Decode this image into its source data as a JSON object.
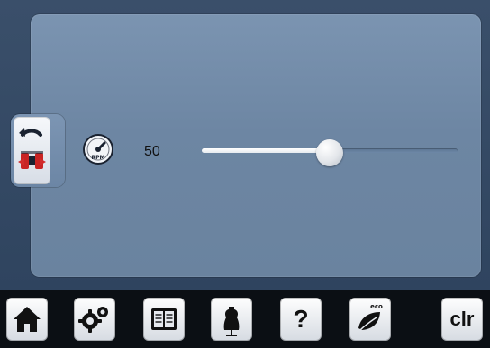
{
  "speed": {
    "value": "50",
    "fraction": 0.5,
    "gauge_label": "RPM"
  },
  "icons": {
    "sidebar_back": "back-arrow-icon",
    "sidebar_sewing_speed": "sewing-foot-speed-icon",
    "gauge": "rpm-gauge-icon",
    "home": "home-icon",
    "settings": "settings-gear-icon",
    "tutorial": "book-icon",
    "creative_consultant": "dress-form-icon",
    "help": "question-mark-icon",
    "eco": "eco-leaf-icon"
  },
  "toolbar": {
    "help_label": "?",
    "clear_label": "clr",
    "eco_label": "eco"
  },
  "colors": {
    "panel": "#7b94b1",
    "accent_red": "#d12b2b",
    "dark_bg": "#0b0f14"
  }
}
